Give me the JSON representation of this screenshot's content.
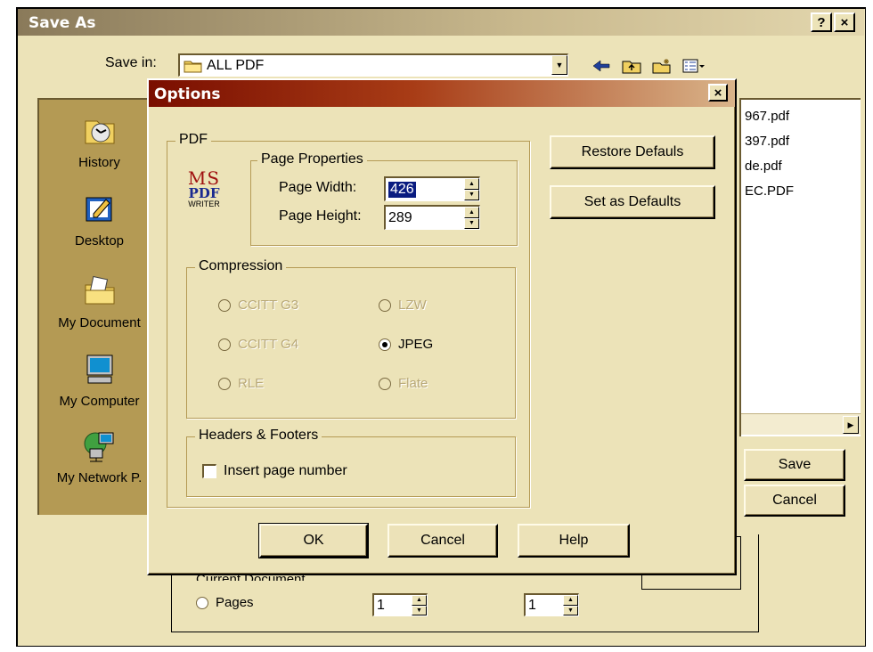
{
  "save_as": {
    "title": "Save As",
    "help_btn": "?",
    "close_btn": "×",
    "save_in_label": "Save in:",
    "save_in_value": "ALL PDF",
    "places": [
      {
        "label": "History",
        "icon": "history-icon"
      },
      {
        "label": "Desktop",
        "icon": "desktop-icon"
      },
      {
        "label": "My Document",
        "icon": "my-documents-icon"
      },
      {
        "label": "My Computer",
        "icon": "my-computer-icon"
      },
      {
        "label": "My Network P.",
        "icon": "network-places-icon"
      }
    ],
    "files": [
      "967.pdf",
      "397.pdf",
      "de.pdf",
      "EC.PDF"
    ],
    "save_button": "Save",
    "cancel_button": "Cancel",
    "pages_label": "Pages",
    "page_from": "1",
    "page_to": "1",
    "current_document_fragment": "Current Document"
  },
  "options": {
    "title": "Options",
    "close_btn": "×",
    "pdf_group": "PDF",
    "logo": {
      "line1": "MS",
      "line2": "PDF",
      "line3": "WRITER"
    },
    "page_properties": {
      "label": "Page Properties",
      "width_label": "Page Width:",
      "width_value": "426",
      "height_label": "Page Height:",
      "height_value": "289"
    },
    "compression": {
      "label": "Compression",
      "options": [
        {
          "label": "CCITT G3",
          "enabled": false,
          "selected": false
        },
        {
          "label": "LZW",
          "enabled": false,
          "selected": false
        },
        {
          "label": "CCITT G4",
          "enabled": false,
          "selected": false
        },
        {
          "label": "JPEG",
          "enabled": true,
          "selected": true
        },
        {
          "label": "RLE",
          "enabled": false,
          "selected": false
        },
        {
          "label": "Flate",
          "enabled": false,
          "selected": false
        }
      ]
    },
    "headers_footers": {
      "label": "Headers & Footers",
      "insert_page_number": "Insert page number",
      "checked": false
    },
    "restore_defaults": "Restore Defauls",
    "set_as_defaults": "Set as Defaults",
    "ok": "OK",
    "cancel": "Cancel",
    "help": "Help"
  }
}
